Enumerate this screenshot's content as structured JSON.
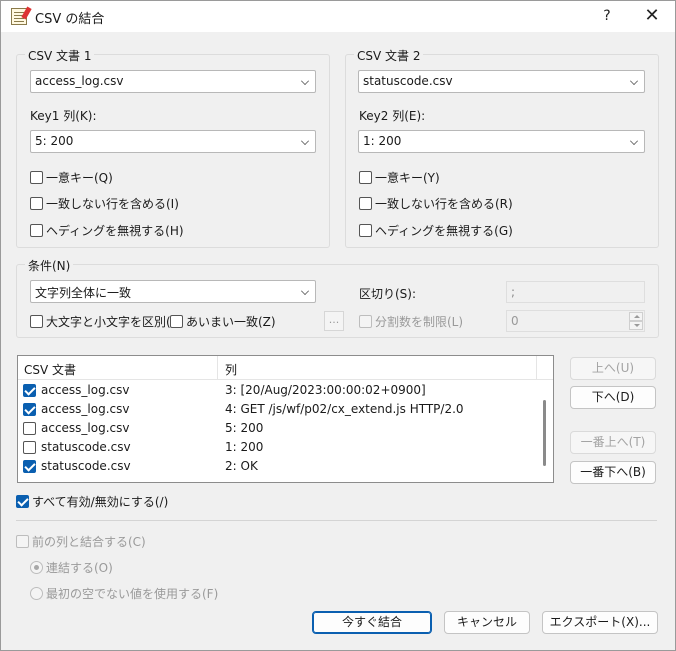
{
  "window": {
    "title": "CSV の結合",
    "help_label": "?",
    "close_label": "✕"
  },
  "doc1": {
    "legend": "CSV 文書 1",
    "file": "access_log.csv",
    "key_label": "Key1 列(K):",
    "key_value": "5: 200",
    "unique_key": "一意キー(Q)",
    "include_unmatched": "一致しない行を含める(I)",
    "ignore_heading": "ヘディングを無視する(H)"
  },
  "doc2": {
    "legend": "CSV 文書 2",
    "file": "statuscode.csv",
    "key_label": "Key2 列(E):",
    "key_value": "1: 200",
    "unique_key": "一意キー(Y)",
    "include_unmatched": "一致しない行を含める(R)",
    "ignore_heading": "ヘディングを無視する(G)"
  },
  "condition": {
    "legend": "条件(N)",
    "mode": "文字列全体に一致",
    "case_sensitive": "大文字と小文字を区別(",
    "fuzzy": "あいまい一致(Z)",
    "ellipsis": "...",
    "delimiter_label": "区切り(S):",
    "delimiter_value": ";",
    "limit_split": "分割数を制限(L)",
    "limit_value": "0"
  },
  "list": {
    "col_doc": "CSV 文書",
    "col_column": "列",
    "rows": [
      {
        "doc": "access_log.csv",
        "column": "3: [20/Aug/2023:00:00:02+0900]",
        "checked": true
      },
      {
        "doc": "access_log.csv",
        "column": "4: GET /js/wf/p02/cx_extend.js HTTP/2.0",
        "checked": true
      },
      {
        "doc": "access_log.csv",
        "column": "5: 200",
        "checked": false
      },
      {
        "doc": "statuscode.csv",
        "column": "1: 200",
        "checked": false
      },
      {
        "doc": "statuscode.csv",
        "column": "2: OK",
        "checked": true
      }
    ]
  },
  "side_buttons": {
    "up": "上へ(U)",
    "down": "下へ(D)",
    "top": "一番上へ(T)",
    "bottom": "一番下へ(B)"
  },
  "toggle_all": "すべて有効/無効にする(/)",
  "join_previous": "前の列と結合する(C)",
  "concat": "連結する(O)",
  "first_nonempty": "最初の空でない値を使用する(F)",
  "footer": {
    "join_now": "今すぐ結合",
    "cancel": "キャンセル",
    "export": "エクスポート(X)..."
  }
}
